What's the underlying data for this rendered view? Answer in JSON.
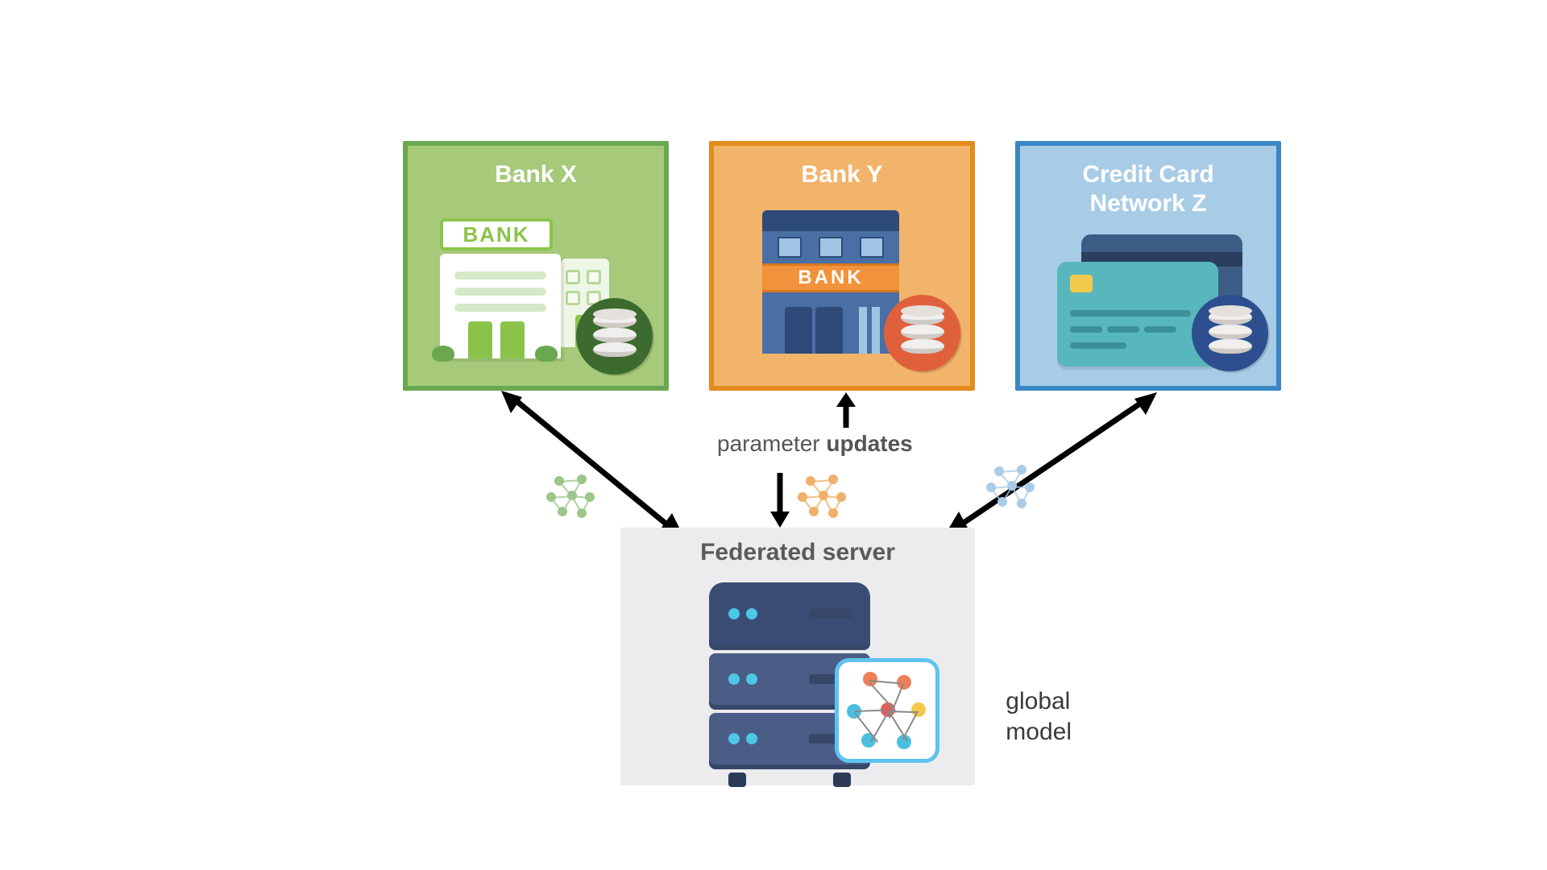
{
  "nodes": {
    "bankX": {
      "title": "Bank X",
      "sign": "BANK"
    },
    "bankY": {
      "title": "Bank Y",
      "sign": "BANK"
    },
    "ccZ": {
      "title": "Credit Card\nNetwork Z"
    }
  },
  "flow": {
    "label_light": "parameter ",
    "label_bold": "updates"
  },
  "server": {
    "title": "Federated server",
    "global_model_label": "global\nmodel"
  },
  "colors": {
    "green_border": "#6aa84f",
    "green_fill": "#a6c97a",
    "orange_border": "#e38b1e",
    "orange_fill": "#f2b46a",
    "blue_border": "#3a87c4",
    "blue_fill": "#a8cce6",
    "server_bg": "#ececee"
  }
}
